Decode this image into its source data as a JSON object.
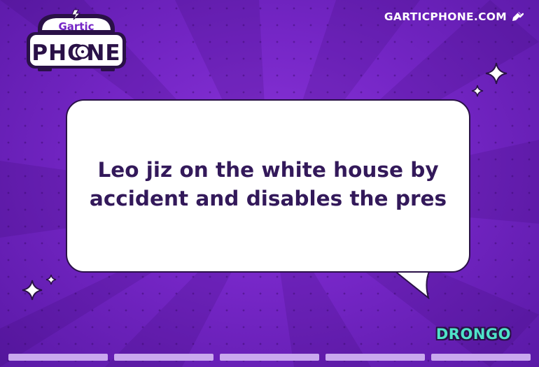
{
  "logo": {
    "line1": "Gartic",
    "line2": "PHONE"
  },
  "header": {
    "site_link": "GARTICPHONE.COM",
    "site_icon": "pencil-edit-icon"
  },
  "speech_bubble": {
    "phrase": "Leo jiz on the white house by accident and disables the pres"
  },
  "author": {
    "name": "DRONGO"
  },
  "progress": {
    "segments": 5,
    "colors": {
      "segment": "#c9a8ee"
    }
  },
  "colors": {
    "background": "#7526c6",
    "text_dark": "#33195a",
    "author_text": "#4fe3c8",
    "outline": "#2a1147"
  }
}
